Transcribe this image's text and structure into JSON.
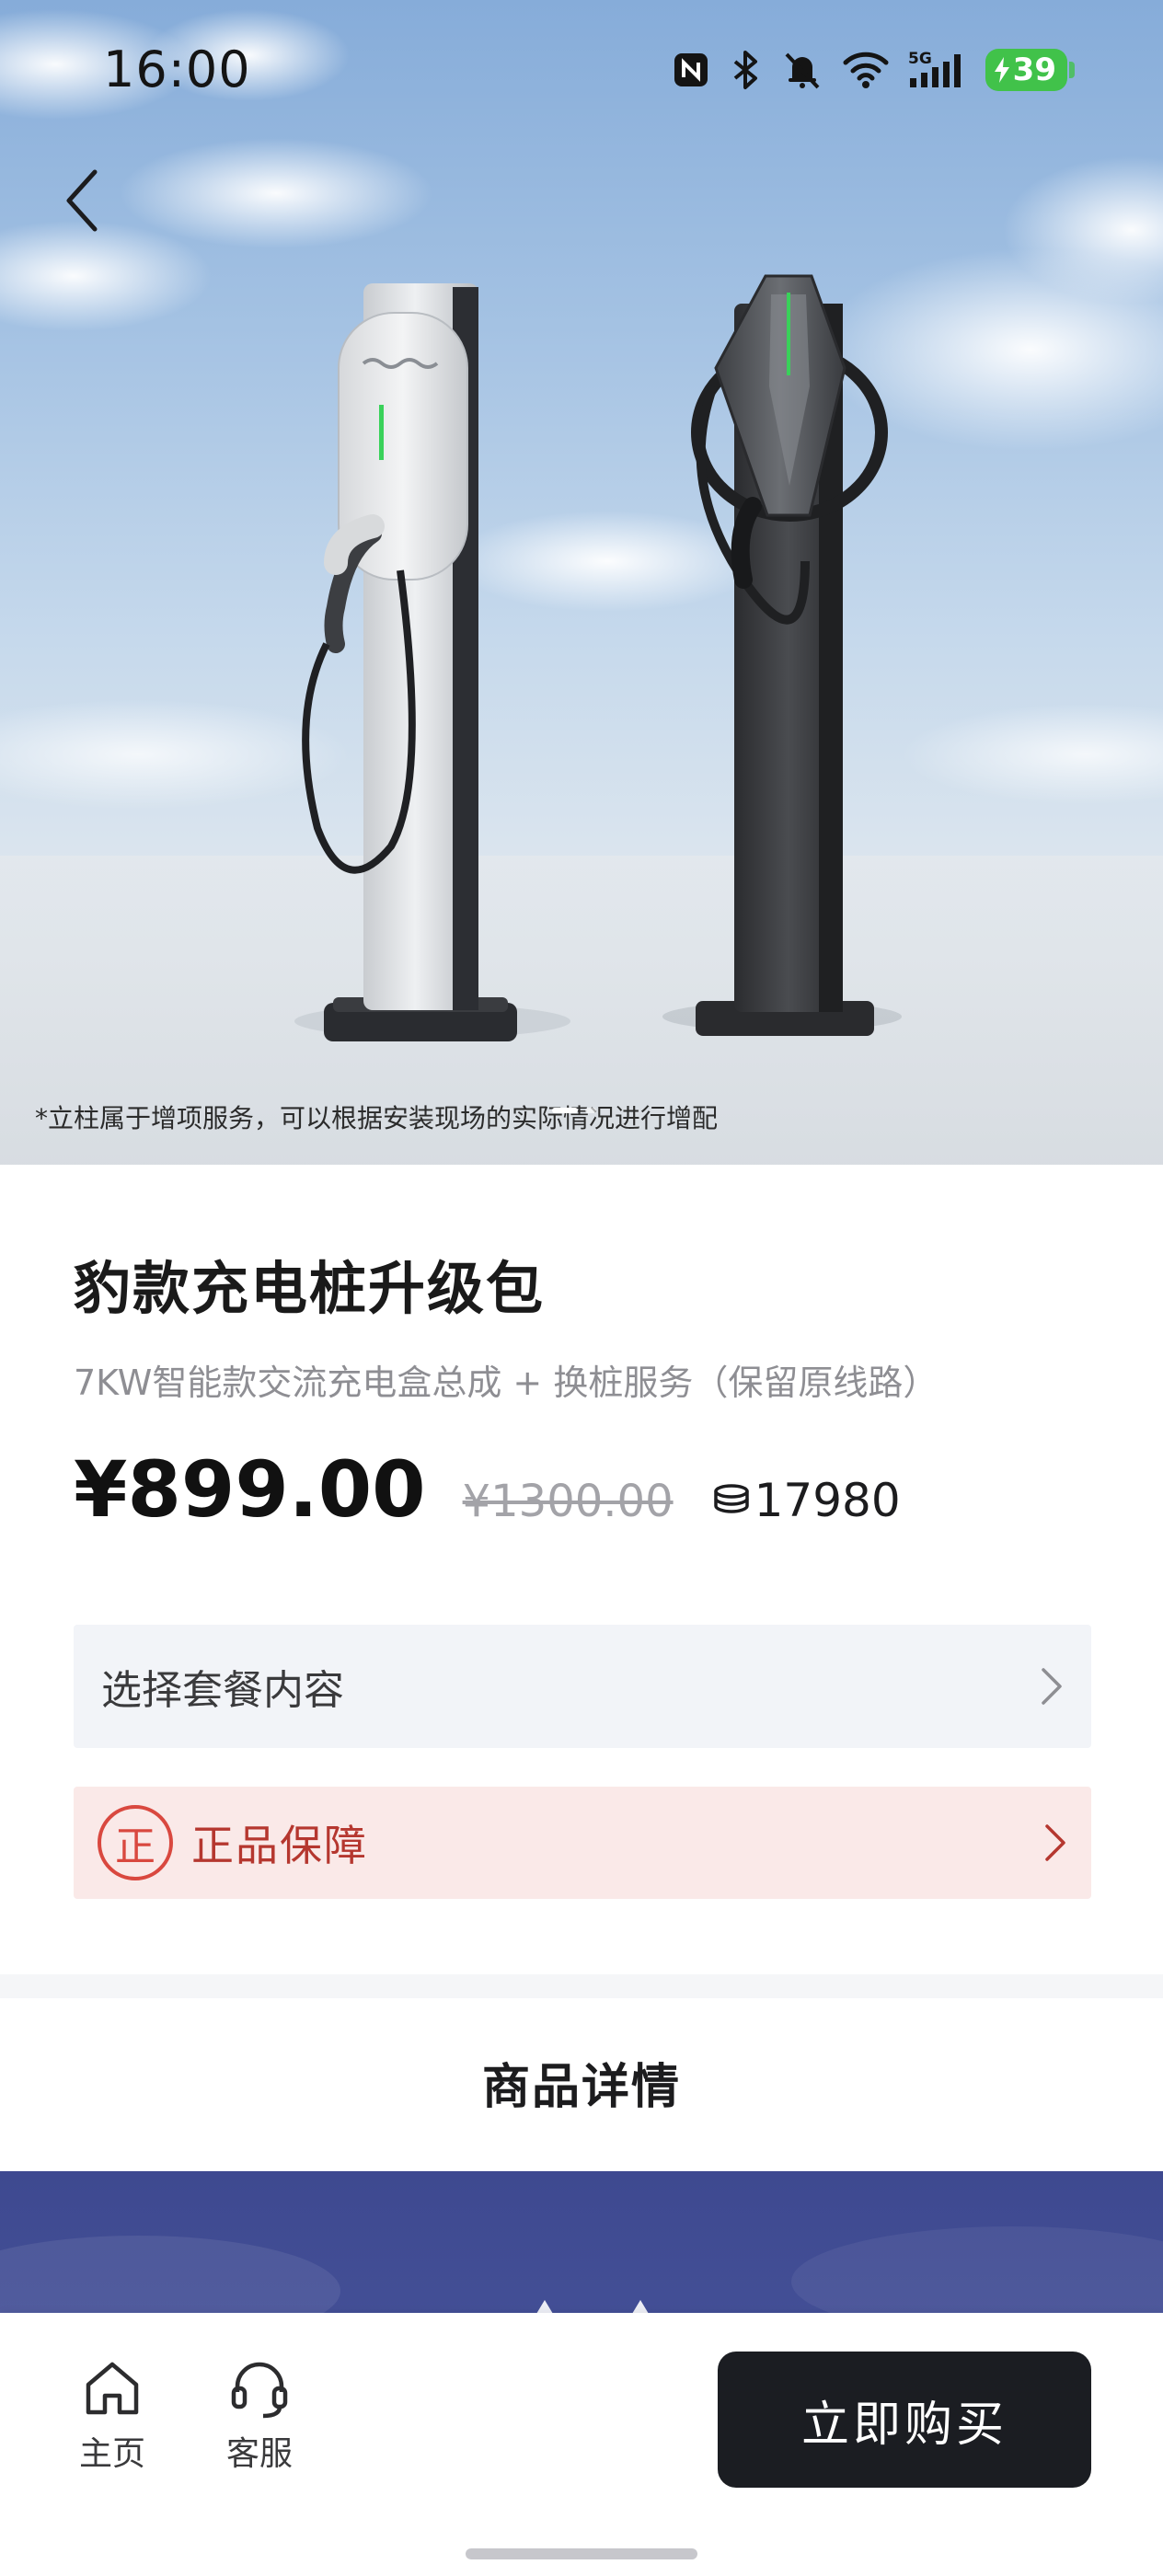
{
  "status_bar": {
    "time": "16:00",
    "network": "5G",
    "battery": "39",
    "icons": [
      "nfc-icon",
      "bluetooth-icon",
      "mute-bell-icon",
      "wifi-icon",
      "signal-icon",
      "battery-charging-icon"
    ]
  },
  "hero": {
    "note": "*立柱属于增项服务，可以根据安装现场的实际情况进行增配",
    "carousel_active_index": 0
  },
  "product": {
    "title": "豹款充电桩升级包",
    "subtitle": "7KW智能款交流充电盒总成 + 换桩服务（保留原线路）",
    "price": "¥899.00",
    "original_price": "¥1300.00",
    "points": "17980"
  },
  "options": {
    "package_label": "选择套餐内容",
    "guarantee_badge": "正",
    "guarantee_label": "正品保障"
  },
  "details": {
    "heading": "商品详情"
  },
  "bottom_nav": {
    "home_label": "主页",
    "service_label": "客服",
    "buy_label": "立即购买"
  },
  "colors": {
    "buy_button": "#1b1d22",
    "guarantee_bg": "#fae9e8",
    "guarantee_accent": "#d9483f",
    "detail_banner": "#404b92",
    "battery": "#41c24a"
  }
}
